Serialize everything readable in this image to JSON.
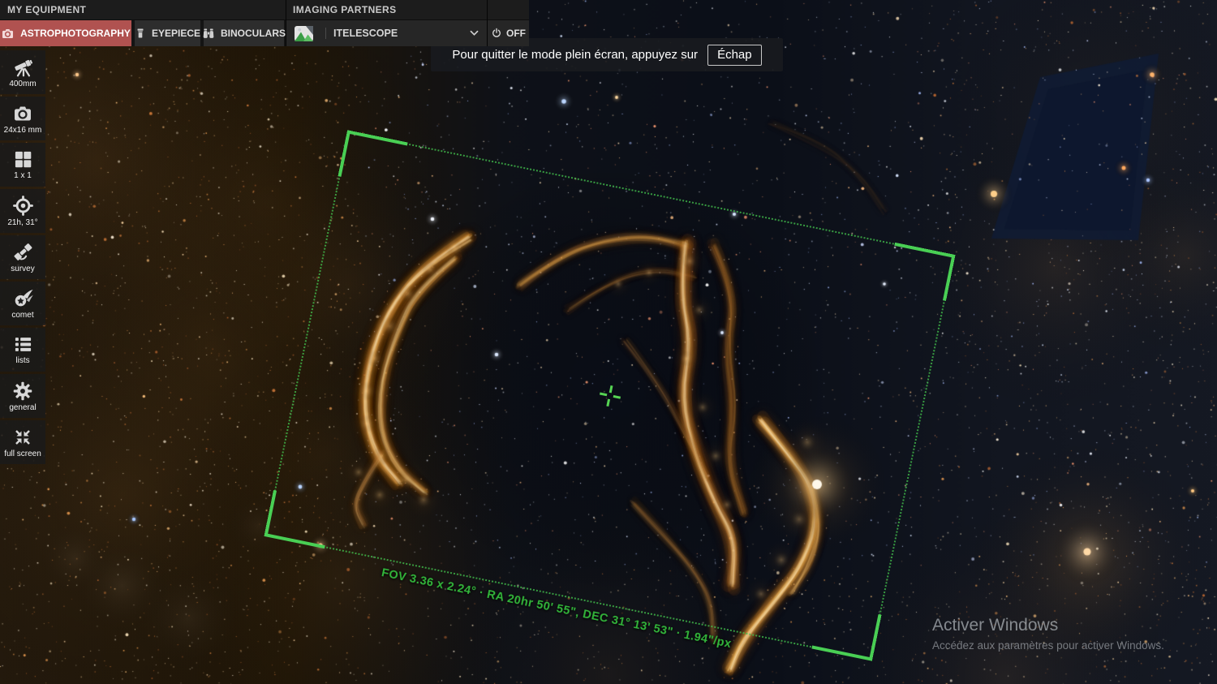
{
  "header": {
    "sections": {
      "my_equipment": "MY EQUIPMENT",
      "imaging_partners": "IMAGING PARTNERS"
    },
    "tabs": [
      {
        "label": "ASTROPHOTOGRAPHY",
        "active": true
      },
      {
        "label": "EYEPIECE",
        "active": false
      },
      {
        "label": "BINOCULARS",
        "active": false
      }
    ],
    "partner_select": {
      "value": "ITELESCOPE"
    },
    "power_toggle": {
      "label": "OFF"
    }
  },
  "sidebar": {
    "items": [
      {
        "id": "telescope",
        "label": "400mm"
      },
      {
        "id": "camera",
        "label": "24x16 mm"
      },
      {
        "id": "grid",
        "label": "1 x 1"
      },
      {
        "id": "target",
        "label": "21h, 31°"
      },
      {
        "id": "survey",
        "label": "survey"
      },
      {
        "id": "comet",
        "label": "comet"
      },
      {
        "id": "lists",
        "label": "lists"
      },
      {
        "id": "general",
        "label": "general"
      },
      {
        "id": "fullscreen",
        "label": "full screen"
      }
    ]
  },
  "toast": {
    "message": "Pour quitter le mode plein écran, appuyez sur",
    "key": "Échap"
  },
  "fov_overlay": {
    "label": "FOV 3.36 x 2.24° · RA 20hr 50' 55\", DEC 31° 13' 53\" · 1.94\"/px"
  },
  "watermark": {
    "title": "Activer Windows",
    "subtitle": "Accédez aux paramètres pour activer Windows."
  },
  "colors": {
    "accent_red": "#b05250",
    "fov_green": "#49cf54"
  }
}
